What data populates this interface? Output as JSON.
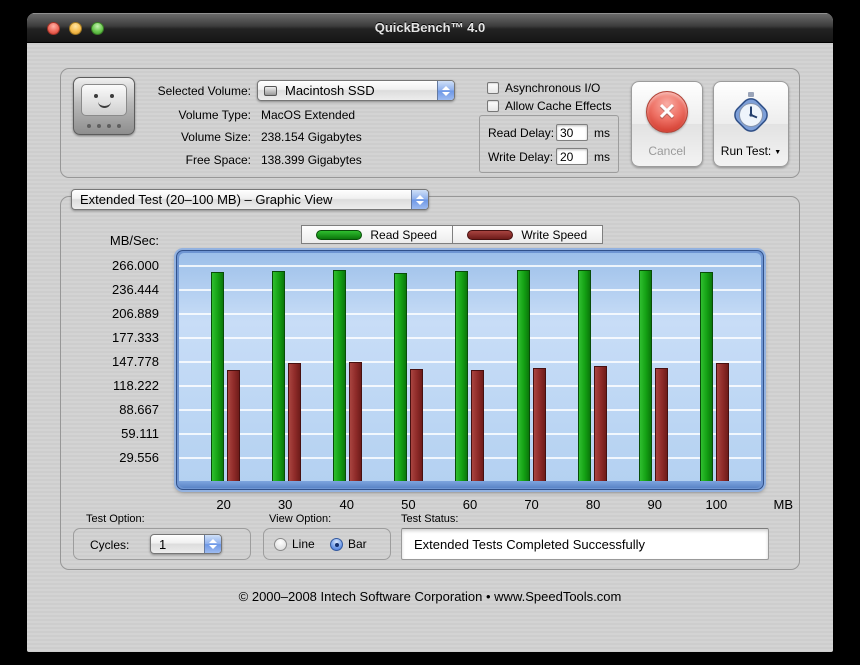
{
  "window": {
    "title": "QuickBench™ 4.0",
    "footer": "© 2000–2008 Intech Software Corporation • www.SpeedTools.com"
  },
  "icons": {
    "cancel_x": "✕",
    "dropdown_caret": "▼"
  },
  "volume_panel": {
    "selected_volume": {
      "label": "Selected Volume:",
      "value": "Macintosh SSD"
    },
    "volume_type": {
      "label": "Volume Type:",
      "value": "MacOS Extended"
    },
    "volume_size": {
      "label": "Volume Size:",
      "value": "238.154 Gigabytes"
    },
    "free_space": {
      "label": "Free Space:",
      "value": "138.399 Gigabytes"
    },
    "async_io": {
      "label": "Asynchronous I/O",
      "checked": false
    },
    "cache_effects": {
      "label": "Allow Cache Effects",
      "checked": false
    },
    "read_delay": {
      "label": "Read Delay:",
      "value": "30",
      "unit": "ms"
    },
    "write_delay": {
      "label": "Write Delay:",
      "value": "20",
      "unit": "ms"
    },
    "cancel_button_label": "Cancel",
    "run_test_button_label": "Run Test:"
  },
  "test_panel": {
    "view_selector": "Extended Test (20–100 MB) – Graphic View",
    "test_option_label": "Test Option:",
    "cycles_label": "Cycles:",
    "cycles_value": "1",
    "view_option_label": "View Option:",
    "line_label": "Line",
    "bar_label": "Bar",
    "selected_view_option": "Bar",
    "test_status_label": "Test Status:",
    "status_text": "Extended Tests Completed Successfully"
  },
  "chart_data": {
    "type": "bar",
    "title": "Extended Test (20–100 MB) – Graphic View",
    "ylabel": "MB/Sec:",
    "x_unit": "MB",
    "categories": [
      20,
      30,
      40,
      50,
      60,
      70,
      80,
      90,
      100
    ],
    "series": [
      {
        "name": "Read Speed",
        "values": [
          259,
          260,
          261,
          258,
          260,
          261,
          261,
          261,
          259
        ],
        "color": "#13a013",
        "color_light": "#2fbf2f",
        "color_dark": "#0b770b",
        "edge": "#084d08"
      },
      {
        "name": "Write Speed",
        "values": [
          138,
          146,
          148,
          139,
          138,
          141,
          143,
          141,
          146
        ],
        "color": "#8e2a28",
        "color_light": "#a84440",
        "color_dark": "#6e1c1a",
        "edge": "#471010"
      }
    ],
    "y_ticks": [
      "266.000",
      "236.444",
      "206.889",
      "177.333",
      "147.778",
      "118.222",
      "88.667",
      "59.111",
      "29.556"
    ],
    "ylim": [
      0,
      282
    ],
    "grid": true,
    "legend_position": "top"
  }
}
